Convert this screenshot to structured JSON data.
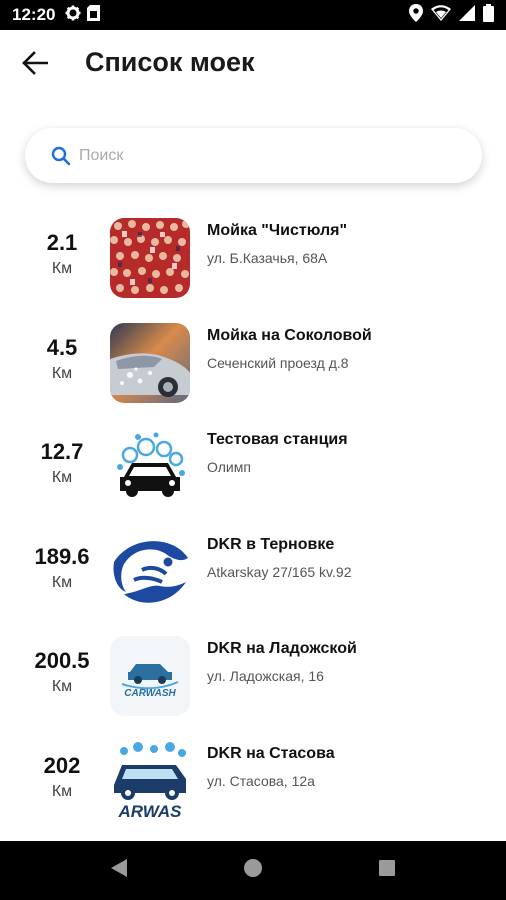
{
  "status_bar": {
    "time": "12:20",
    "left_icons": [
      "gear-icon",
      "sim-card-icon"
    ],
    "right_icons": [
      "location-icon",
      "wifi-icon",
      "signal-icon",
      "battery-icon"
    ]
  },
  "header": {
    "title": "Список моек",
    "back_icon": "arrow-back-icon"
  },
  "search": {
    "placeholder": "Поиск",
    "value": "",
    "icon": "search-icon",
    "accent_color": "#1e6fd9"
  },
  "car_washes": [
    {
      "distance": "2.1",
      "unit": "Км",
      "name": "Мойка \"Чистюля\"",
      "address": "ул. Б.Казачья, 68А",
      "thumbnail": "crowd-photo"
    },
    {
      "distance": "4.5",
      "unit": "Км",
      "name": "Мойка на Соколовой",
      "address": " Сеченский проезд д.8",
      "thumbnail": "car-wash-photo"
    },
    {
      "distance": "12.7",
      "unit": "Км",
      "name": "Тестовая станция",
      "address": "Олимп",
      "thumbnail": "car-bubbles-logo"
    },
    {
      "distance": "189.6",
      "unit": "Км",
      "name": "DKR в Терновке",
      "address": "Atkarskay 27/165 kv.92",
      "thumbnail": "fish-logo"
    },
    {
      "distance": "200.5",
      "unit": "Км",
      "name": "DKR на Ладожской",
      "address": "ул. Ладожская, 16",
      "thumbnail": "carwash-logo",
      "logo_text": "CARWASH"
    },
    {
      "distance": "202",
      "unit": "Км",
      "name": "DKR на Стасова",
      "address": "ул. Стасова, 12а",
      "thumbnail": "carwash-car-logo",
      "logo_text": "ARWAS"
    }
  ],
  "nav_bar": {
    "buttons": [
      "back-triangle-icon",
      "home-circle-icon",
      "recents-square-icon"
    ]
  }
}
